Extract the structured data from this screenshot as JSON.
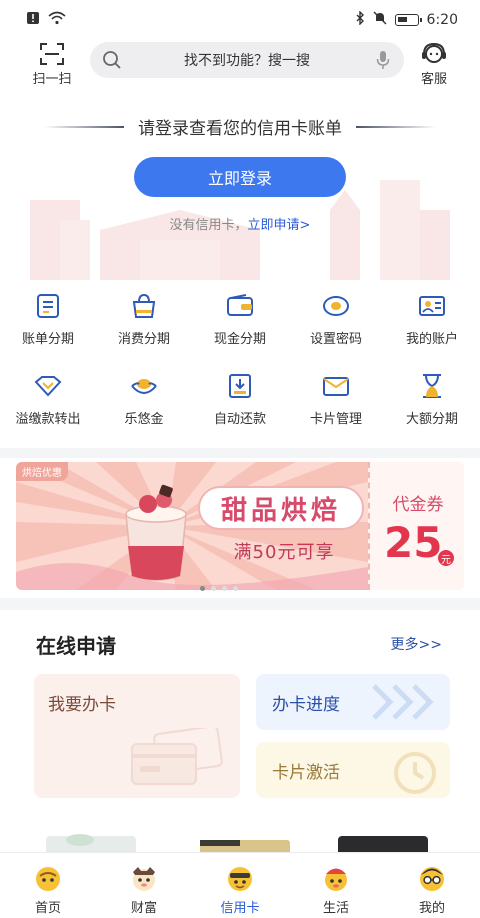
{
  "status_bar": {
    "time": "6:20"
  },
  "top_bar": {
    "scan_label": "扫一扫",
    "search_placeholder": "找不到功能？搜一搜",
    "service_label": "客服"
  },
  "hero": {
    "title": "请登录查看您的信用卡账单",
    "login_button": "立即登录",
    "no_card_text": "没有信用卡，",
    "apply_link": "立即申请>"
  },
  "function_grid": [
    {
      "label": "账单分期",
      "icon": "bill-icon"
    },
    {
      "label": "消费分期",
      "icon": "shopping-bag-icon"
    },
    {
      "label": "现金分期",
      "icon": "wallet-icon"
    },
    {
      "label": "设置密码",
      "icon": "password-icon"
    },
    {
      "label": "我的账户",
      "icon": "account-card-icon"
    },
    {
      "label": "溢缴款转出",
      "icon": "diamond-icon"
    },
    {
      "label": "乐悠金",
      "icon": "gold-ingot-icon"
    },
    {
      "label": "自动还款",
      "icon": "auto-repay-icon"
    },
    {
      "label": "卡片管理",
      "icon": "card-manage-icon"
    },
    {
      "label": "大额分期",
      "icon": "hourglass-icon"
    }
  ],
  "banner": {
    "tag": "烘焙优惠",
    "title": "甜品烘焙",
    "subtitle": "满50元可享",
    "coupon_label": "代金券",
    "coupon_amount": "25",
    "coupon_unit": "元",
    "slide_count": 4,
    "active_slide": 1
  },
  "online_apply": {
    "title": "在线申请",
    "more_link": "更多>>",
    "apply_card": "我要办卡",
    "progress": "办卡进度",
    "activate": "卡片激活"
  },
  "tab_bar": {
    "tabs": [
      {
        "label": "首页",
        "icon": "home-face-icon"
      },
      {
        "label": "财富",
        "icon": "wealth-face-icon"
      },
      {
        "label": "信用卡",
        "icon": "credit-card-face-icon"
      },
      {
        "label": "生活",
        "icon": "life-face-icon"
      },
      {
        "label": "我的",
        "icon": "mine-face-icon"
      }
    ],
    "active_tab": "信用卡"
  },
  "colors": {
    "primary": "#3e78ee",
    "link": "#2a5bd7",
    "banner_accent": "#d84a6b"
  }
}
